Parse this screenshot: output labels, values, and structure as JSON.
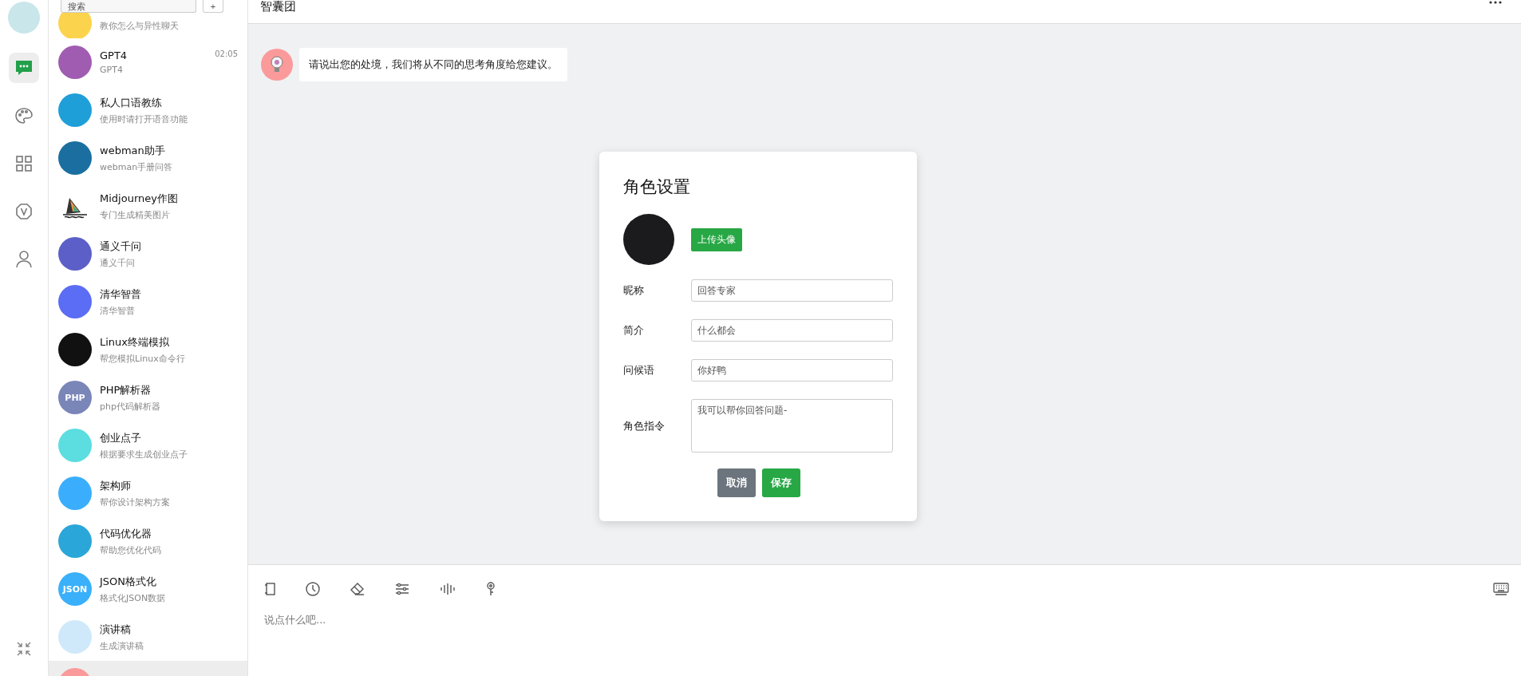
{
  "rail": {
    "items": [
      {
        "kind": "chat",
        "selected": true
      },
      {
        "kind": "palette",
        "selected": false
      },
      {
        "kind": "grid",
        "selected": false
      },
      {
        "kind": "v",
        "selected": false
      },
      {
        "kind": "user",
        "selected": false
      }
    ]
  },
  "search": {
    "placeholder": "搜索",
    "add_label": "+"
  },
  "conversations": [
    {
      "subtitle": "教你怎么与异性聊天",
      "color": "#fcd34d",
      "selected": false
    },
    {
      "title": "GPT4",
      "subtitle": "GPT4",
      "time": "02:05",
      "color": "#a05cb0",
      "selected": false
    },
    {
      "title": "私人口语教练",
      "subtitle": "使用时请打开语音功能",
      "color": "#1e9fd8",
      "selected": false
    },
    {
      "title": "webman助手",
      "subtitle": "webman手册问答",
      "color": "#1a6fa0",
      "selected": false
    },
    {
      "title": "Midjourney作图",
      "subtitle": "专门生成精美图片",
      "color": "#ffffff",
      "kind": "sailboat",
      "selected": false
    },
    {
      "title": "通义千问",
      "subtitle": "通义千问",
      "color": "#5b5fc7",
      "selected": false
    },
    {
      "title": "清华智普",
      "subtitle": "清华智普",
      "color": "#5b6cf5",
      "selected": false
    },
    {
      "title": "Linux终端模拟",
      "subtitle": "帮您模拟Linux命令行",
      "color": "#111111",
      "selected": false
    },
    {
      "title": "PHP解析器",
      "subtitle": "php代码解析器",
      "avatar_text": "PHP",
      "color": "#7a86b8",
      "selected": false
    },
    {
      "title": "创业点子",
      "subtitle": "根据要求生成创业点子",
      "color": "#5cdde0",
      "selected": false
    },
    {
      "title": "架构师",
      "subtitle": "帮你设计架构方案",
      "color": "#3aaefc",
      "selected": false
    },
    {
      "title": "代码优化器",
      "subtitle": "帮助您优化代码",
      "color": "#2aa6d8",
      "selected": false
    },
    {
      "title": "JSON格式化",
      "subtitle": "格式化JSON数据",
      "avatar_text": "JSON",
      "color": "#3ab0fa",
      "selected": false
    },
    {
      "title": "演讲稿",
      "subtitle": "生成演讲稿",
      "color": "#cfe9fb",
      "selected": false
    },
    {
      "color": "#fb9a9a",
      "selected": true
    }
  ],
  "chat": {
    "title": "智囊团",
    "messages": [
      {
        "text": "请说出您的处境，我们将从不同的思考角度给您建议。"
      }
    ]
  },
  "dialog": {
    "title": "角色设置",
    "upload_label": "上传头像",
    "fields": [
      {
        "kind": "input",
        "label": "昵称",
        "value": "回答专家"
      },
      {
        "kind": "input",
        "label": "简介",
        "value": "什么都会"
      },
      {
        "kind": "input",
        "label": "问候语",
        "value": "你好鸭"
      },
      {
        "kind": "textarea",
        "label": "角色指令",
        "value": "我可以帮你回答问题-"
      }
    ],
    "buttons": [
      {
        "kind": "cancel",
        "label": "取消"
      },
      {
        "kind": "save",
        "label": "保存"
      }
    ]
  },
  "composer": {
    "tools": [
      {
        "kind": "book"
      },
      {
        "kind": "clock"
      },
      {
        "kind": "eraser"
      },
      {
        "kind": "sliders"
      },
      {
        "kind": "wave"
      },
      {
        "kind": "key"
      }
    ],
    "placeholder": "说点什么吧..."
  }
}
